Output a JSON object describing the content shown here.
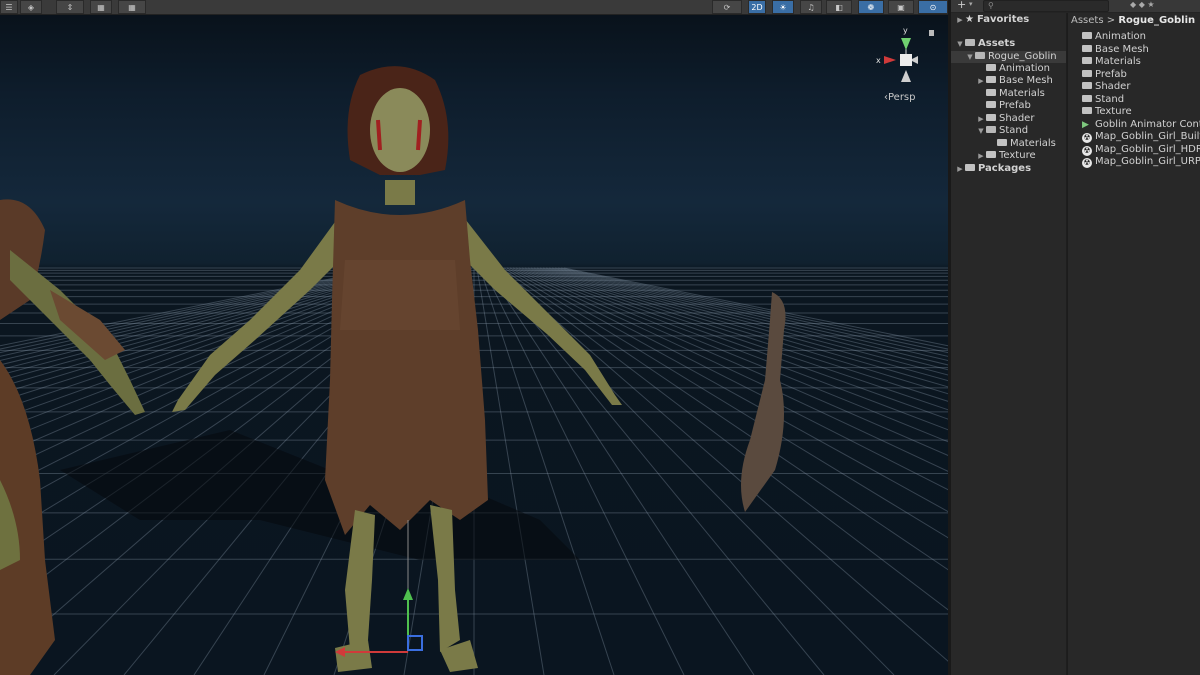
{
  "scene": {
    "persp_label": "‹Persp",
    "gizmo": {
      "x_label": "x",
      "y_label": "y"
    },
    "toolbar_buttons": [
      "2D",
      "☀",
      "♫",
      "◧",
      "❁",
      "▣",
      "⊙"
    ]
  },
  "project": {
    "search_placeholder": "",
    "tree": {
      "favorites": "Favorites",
      "assets": "Assets",
      "rogue_goblin": "Rogue_Goblin",
      "children": [
        "Animation",
        "Base Mesh",
        "Materials",
        "Prefab",
        "Shader",
        "Stand",
        "Materials",
        "Texture"
      ],
      "packages": "Packages"
    },
    "breadcrumb": {
      "root": "Assets",
      "sep": ">",
      "current": "Rogue_Goblin"
    },
    "list_items": [
      "Animation",
      "Base Mesh",
      "Materials",
      "Prefab",
      "Shader",
      "Stand",
      "Texture",
      "Goblin Animator Controller",
      "Map_Goblin_Girl_Builtin",
      "Map_Goblin_Girl_HDRP",
      "Map_Goblin_Girl_URP"
    ]
  }
}
